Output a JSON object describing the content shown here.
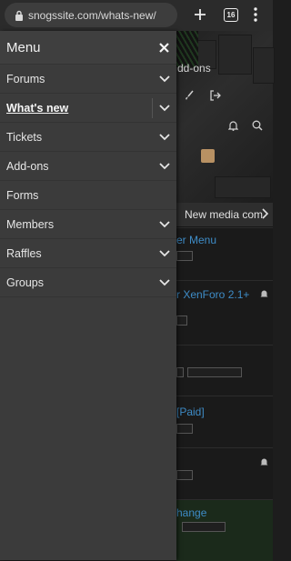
{
  "browser": {
    "url": "snogssite.com/whats-new/",
    "tab_count": "16"
  },
  "menu": {
    "title": "Menu",
    "items": [
      {
        "label": "Forums",
        "expandable": true,
        "active": false
      },
      {
        "label": "What's new",
        "expandable": true,
        "active": true
      },
      {
        "label": "Tickets",
        "expandable": true,
        "active": false
      },
      {
        "label": "Add-ons",
        "expandable": true,
        "active": false
      },
      {
        "label": "Forms",
        "expandable": false,
        "active": false
      },
      {
        "label": "Members",
        "expandable": true,
        "active": false
      },
      {
        "label": "Raffles",
        "expandable": true,
        "active": false
      },
      {
        "label": "Groups",
        "expandable": true,
        "active": false
      }
    ]
  },
  "background": {
    "hero_text": "dd-ons",
    "new_media_button": "New media com",
    "threads": [
      {
        "title": "er Menu"
      },
      {
        "title": "r XenForo 2.1+"
      },
      {
        "title": ""
      },
      {
        "title": "[Paid]"
      },
      {
        "title": ""
      },
      {
        "title": "hange"
      }
    ]
  },
  "colors": {
    "menu_bg": "#3b3b3b",
    "link": "#3e8cc7",
    "chrome_bg": "#2b2b2b"
  }
}
